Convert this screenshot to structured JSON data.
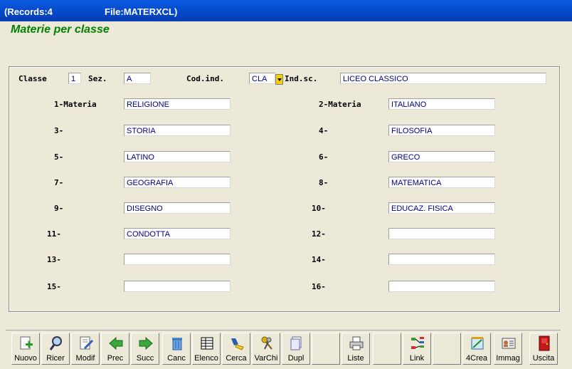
{
  "window": {
    "records": "(Records:4",
    "file": "File:MATERXCL)"
  },
  "form": {
    "title": "Materie per classe"
  },
  "header": {
    "classe_label": "Classe",
    "classe_value": "1",
    "sez_label": "Sez.",
    "sez_value": "A",
    "codind_label": "Cod.ind.",
    "codind_value": "CLA",
    "indsc_label": "Ind.sc.",
    "indsc_value": "LICEO CLASSICO"
  },
  "subjects": [
    {
      "label": "1-Materia",
      "value": "RELIGIONE"
    },
    {
      "label": "2-Materia",
      "value": "ITALIANO"
    },
    {
      "label": "3-",
      "value": "STORIA"
    },
    {
      "label": "4-",
      "value": "FILOSOFIA"
    },
    {
      "label": "5-",
      "value": "LATINO"
    },
    {
      "label": "6-",
      "value": "GRECO"
    },
    {
      "label": "7-",
      "value": "GEOGRAFIA"
    },
    {
      "label": "8-",
      "value": "MATEMATICA"
    },
    {
      "label": "9-",
      "value": "DISEGNO"
    },
    {
      "label": "10-",
      "value": "EDUCAZ. FISICA"
    },
    {
      "label": "11-",
      "value": "CONDOTTA"
    },
    {
      "label": "12-",
      "value": ""
    },
    {
      "label": "13-",
      "value": ""
    },
    {
      "label": "14-",
      "value": ""
    },
    {
      "label": "15-",
      "value": ""
    },
    {
      "label": "16-",
      "value": ""
    }
  ],
  "toolbar": {
    "nuovo": "Nuovo",
    "ricer": "Ricer",
    "modif": "Modif",
    "prec": "Prec",
    "succ": "Succ",
    "canc": "Canc",
    "elenco": "Elenco",
    "cerca": "Cerca",
    "varchi": "VarChi",
    "dupl": "Dupl",
    "liste": "Liste",
    "link": "Link",
    "crea": "4Crea",
    "immag": "Immag",
    "uscita": "Uscita"
  }
}
